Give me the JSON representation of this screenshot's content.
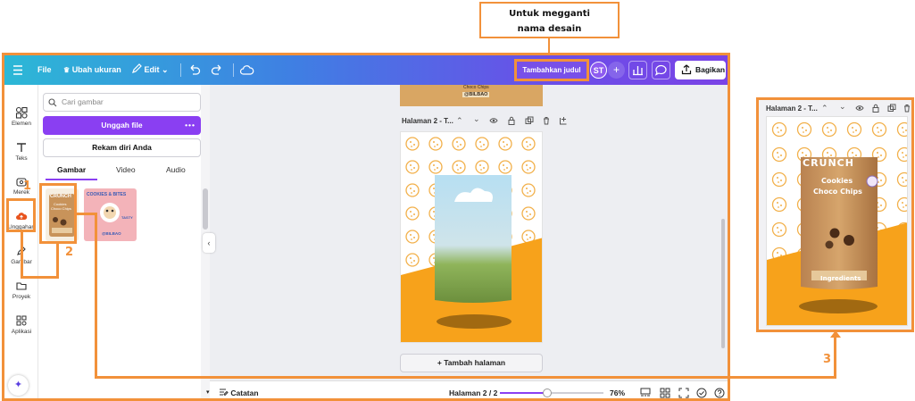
{
  "annotations": {
    "callout_text": "Untuk megganti nama desain",
    "step1": "1",
    "step2": "2",
    "step3": "3"
  },
  "topbar": {
    "menu_icon": "hamburger-icon",
    "file": "File",
    "resize": "Ubah ukuran",
    "edit": "Edit",
    "title_button": "Tambahkan judul",
    "avatar": "ST",
    "share": "Bagikan"
  },
  "rail": {
    "items": [
      {
        "label": "Elemen",
        "icon": "shapes-icon"
      },
      {
        "label": "Teks",
        "icon": "text-icon"
      },
      {
        "label": "Merek",
        "icon": "brand-icon"
      },
      {
        "label": "Unggahan",
        "icon": "upload-cloud-icon"
      },
      {
        "label": "Gambar",
        "icon": "draw-icon"
      },
      {
        "label": "Proyek",
        "icon": "folder-icon"
      },
      {
        "label": "Aplikasi",
        "icon": "apps-icon"
      }
    ]
  },
  "panel": {
    "search_placeholder": "Cari gambar",
    "upload_button": "Unggah file",
    "record_button": "Rekam diri Anda",
    "tabs": [
      "Gambar",
      "Video",
      "Audio"
    ],
    "active_tab": "Gambar",
    "thumb1": {
      "brand": "CRUNCH",
      "line1": "Cookies",
      "line2": "Choco Chips"
    },
    "thumb2": {
      "text": "COOKIES & BITES",
      "tag": "TASTY",
      "brand": "@BILBAO"
    }
  },
  "canvas": {
    "prev_page_text": "Choco Chips",
    "prev_page_handle": "@BILBAO",
    "page_label": "Halaman 2 - T...",
    "add_page": "+ Tambah halaman"
  },
  "bottombar": {
    "notes": "Catatan",
    "page_indicator": "Halaman 2 / 2",
    "zoom": "76%",
    "zoom_fraction": 0.46
  },
  "zoom_panel": {
    "page_label": "Halaman 2 - T...",
    "brand": "CRUNCH",
    "line1": "Cookies",
    "line2": "Choco Chips",
    "ingredients": "Ingredients"
  },
  "colors": {
    "accent": "#f2913a",
    "purple": "#8a3ff2",
    "design_orange": "#f7a21b",
    "bag_brown": "#c8935a"
  }
}
